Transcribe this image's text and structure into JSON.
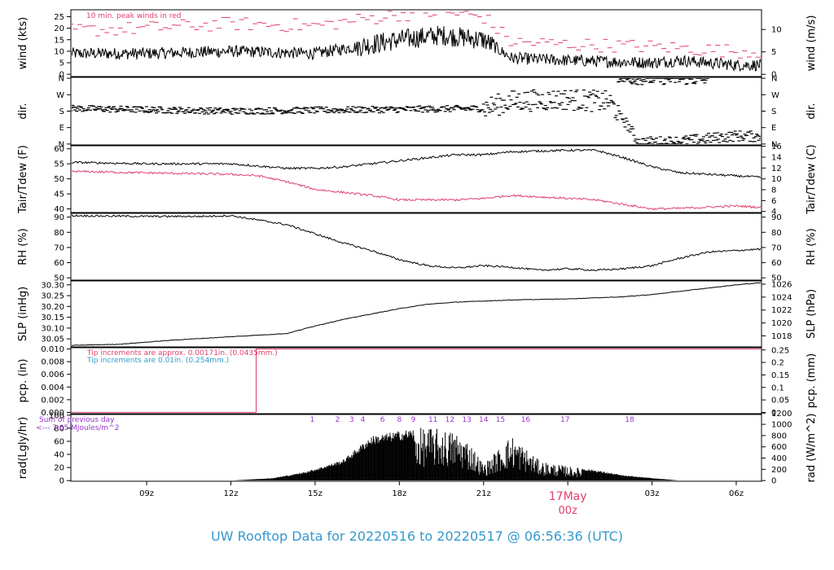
{
  "chart_data": {
    "type": "line",
    "title": "UW Rooftop Data for 20220516  to  20220517 @ 06:56:36  (UTC)",
    "title_color": "#3399cc",
    "time_axis": {
      "ticks": [
        "09z",
        "12z",
        "15z",
        "18z",
        "21z",
        "03z",
        "06z"
      ],
      "tick_hours": [
        9,
        12,
        15,
        18,
        21,
        27,
        30
      ],
      "date_label": "17May",
      "date_sublabel": "00z",
      "date_label_hour": 24,
      "date_color": "#e0406a",
      "range_hours": [
        6.3,
        30.9
      ]
    },
    "panels": [
      {
        "id": "wind",
        "left_label": "wind (kts)",
        "right_label": "wind (m/s)",
        "left_ticks": [
          "0",
          "5",
          "10",
          "15",
          "20",
          "25"
        ],
        "left_tick_values": [
          0,
          5,
          10,
          15,
          20,
          25
        ],
        "right_ticks": [
          "0",
          "5",
          "10"
        ],
        "right_tick_values": [
          0,
          5,
          10
        ],
        "ylim": [
          -1,
          28
        ],
        "right_ylim": [
          -0.5,
          14.4
        ],
        "annotation": "10 min. peak winds in red",
        "annotation_color": "#e0406a",
        "series": [
          {
            "values_hours": [
              6.3,
              9,
              12,
              15,
              18,
              19.5,
              21,
              22,
              24,
              27,
              28,
              30,
              30.9
            ],
            "values": [
              9,
              9,
              10,
              9,
              15,
              17,
              15,
              7,
              6,
              5,
              6,
              4,
              4
            ],
            "color": "#000000"
          },
          {
            "values_hours": [
              6.3,
              9,
              12,
              15,
              18,
              19.5,
              21,
              22,
              24,
              27,
              30,
              30.9
            ],
            "values": [
              19,
              20,
              22,
              21,
              26,
              27,
              25,
              14,
              13,
              12,
              10,
              10
            ],
            "color": "#e0406a",
            "style": "dashes"
          }
        ]
      },
      {
        "id": "dir",
        "left_label": "dir.",
        "right_label": "dir.",
        "left_ticks": [
          "N",
          "E",
          "S",
          "W",
          "N"
        ],
        "left_tick_values": [
          0,
          90,
          180,
          270,
          360
        ],
        "right_ticks": [
          "N",
          "E",
          "S",
          "W",
          "N"
        ],
        "right_tick_values": [
          0,
          90,
          180,
          270,
          360
        ],
        "ylim": [
          -5,
          365
        ],
        "series": [
          {
            "values_hours": [
              6.3,
              12,
              18,
              21,
              22,
              24,
              25.5,
              26.2,
              26.5,
              28,
              30,
              30.9
            ],
            "values": [
              195,
              180,
              190,
              195,
              235,
              245,
              230,
              90,
              10,
              15,
              45,
              40
            ],
            "color": "#000000",
            "style": "dashes"
          },
          {
            "values_hours": [
              25.8,
              27,
              28,
              29
            ],
            "values": [
              355,
              355,
              355,
              350
            ],
            "color": "#000000",
            "style": "dashes"
          }
        ]
      },
      {
        "id": "temp",
        "left_label": "Tair/Tdew (F)",
        "right_label": "Tair/Tdew (C)",
        "left_ticks": [
          "40",
          "45",
          "50",
          "55",
          "60"
        ],
        "left_tick_values": [
          40,
          45,
          50,
          55,
          60
        ],
        "right_ticks": [
          "4",
          "6",
          "8",
          "10",
          "12",
          "14",
          "16"
        ],
        "right_tick_values": [
          4,
          6,
          8,
          10,
          12,
          14,
          16
        ],
        "ylim": [
          38.8,
          61
        ],
        "right_ylim": [
          3.8,
          16.1
        ],
        "series": [
          {
            "name": "Tair",
            "values_hours": [
              6.3,
              9,
              12,
              14,
              15,
              16,
              18,
              20,
              21,
              22,
              24,
              25,
              26,
              27,
              28,
              30,
              30.9
            ],
            "values": [
              55.5,
              55,
              55,
              53.5,
              53.5,
              54,
              56,
              58,
              58,
              59,
              59.5,
              59.5,
              57,
              54,
              52,
              51,
              50.5
            ],
            "color": "#000000"
          },
          {
            "name": "Tdew",
            "values_hours": [
              6.3,
              9,
              12,
              13,
              14,
              15,
              16,
              17,
              18,
              20,
              21,
              22,
              24,
              25,
              26,
              27,
              28,
              30,
              30.9
            ],
            "values": [
              52.5,
              52,
              51.5,
              51,
              49,
              46.5,
              45.5,
              44.5,
              43,
              43,
              43.5,
              44.5,
              43.5,
              43,
              41.5,
              40,
              40.2,
              41,
              40.5
            ],
            "color": "#e0406a"
          }
        ]
      },
      {
        "id": "rh",
        "left_label": "RH (%)",
        "right_label": "RH (%)",
        "left_ticks": [
          "50",
          "60",
          "70",
          "80",
          "90"
        ],
        "left_tick_values": [
          50,
          60,
          70,
          80,
          90
        ],
        "right_ticks": [
          "50",
          "60",
          "70",
          "80",
          "90"
        ],
        "right_tick_values": [
          50,
          60,
          70,
          80,
          90
        ],
        "ylim": [
          48.5,
          92.5
        ],
        "series": [
          {
            "values_hours": [
              6.3,
              9,
              11,
              12,
              13,
              14,
              15,
              16,
              17,
              18,
              19,
              20,
              21,
              22,
              23,
              24,
              25,
              26,
              27,
              28,
              29,
              30,
              30.9
            ],
            "values": [
              91,
              90.5,
              90.5,
              91,
              88,
              85,
              79,
              73,
              68,
              62,
              58,
              56.5,
              58,
              57,
              55,
              56,
              55,
              56,
              58,
              63,
              67,
              68,
              69
            ],
            "color": "#000000"
          }
        ]
      },
      {
        "id": "slp",
        "left_label": "SLP (inHg)",
        "right_label": "SLP (hPa)",
        "left_ticks": [
          "30.05",
          "30.10",
          "30.15",
          "30.20",
          "30.25",
          "30.30"
        ],
        "left_tick_values": [
          30.05,
          30.1,
          30.15,
          30.2,
          30.25,
          30.3
        ],
        "right_ticks": [
          "1018",
          "1020",
          "1022",
          "1024",
          "1026"
        ],
        "right_tick_values": [
          1018,
          1020,
          1022,
          1024,
          1026
        ],
        "ylim": [
          30.013,
          30.318
        ],
        "right_ylim": [
          1016.3,
          1026.5
        ],
        "series": [
          {
            "values_hours": [
              6.3,
              8,
              10,
              12,
              14,
              15,
              16,
              18,
              19,
              20,
              21,
              22,
              24,
              26,
              27,
              28,
              29,
              30,
              30.9
            ],
            "values": [
              30.02,
              30.025,
              30.045,
              30.06,
              30.075,
              30.11,
              30.14,
              30.19,
              30.21,
              30.22,
              30.225,
              30.23,
              30.235,
              30.245,
              30.255,
              30.27,
              30.285,
              30.3,
              30.31
            ],
            "color": "#000000"
          }
        ]
      },
      {
        "id": "pcp",
        "left_label": "pcp. (in)",
        "right_label": "pcp. (mm)",
        "left_ticks": [
          "0.000",
          "0.002",
          "0.004",
          "0.006",
          "0.008",
          "0.010"
        ],
        "left_tick_values": [
          0,
          0.002,
          0.004,
          0.006,
          0.008,
          0.01
        ],
        "right_ticks": [
          "0",
          "0.05",
          "0.1",
          "0.15",
          "0.2",
          "0.25"
        ],
        "right_tick_values": [
          0,
          0.05,
          0.1,
          0.15,
          0.2,
          0.25
        ],
        "ylim": [
          -0.0002,
          0.0102
        ],
        "right_ylim": [
          -0.005,
          0.259
        ],
        "annotations": [
          {
            "text": "Tip increments are approx. 0.00171in. (0.0435mm.)",
            "color": "#e0406a"
          },
          {
            "text": "Tip increments are 0.01in. (0.254mm.)",
            "color": "#3399cc"
          }
        ],
        "series": [
          {
            "values_hours": [
              6.3,
              12.9,
              12.9,
              30.9
            ],
            "values": [
              0,
              0,
              0.01,
              0.01
            ],
            "color": "#e0406a"
          }
        ]
      },
      {
        "id": "rad",
        "left_label": "rad(Lgly/hr)",
        "right_label": "rad (W/m^2)",
        "left_ticks": [
          "0",
          "20",
          "40",
          "60",
          "80",
          "100"
        ],
        "left_tick_values": [
          0,
          20,
          40,
          60,
          80,
          100
        ],
        "right_ticks": [
          "0",
          "200",
          "400",
          "600",
          "800",
          "1000",
          "1200"
        ],
        "right_tick_values": [
          0,
          200,
          400,
          600,
          800,
          1000,
          1200
        ],
        "ylim": [
          -1,
          101
        ],
        "right_ylim": [
          -12,
          1175
        ],
        "annotations": [
          {
            "text": "Sum of previous day",
            "color": "#9933cc"
          },
          {
            "text": "<--- 7.65 MJoules/m^2",
            "color": "#9933cc"
          }
        ],
        "hour_labels": [
          "1",
          "2",
          "3",
          "4",
          "6",
          "8",
          "9",
          "11",
          "12",
          "13",
          "14",
          "15",
          "16",
          "17",
          "18"
        ],
        "hour_label_hours": [
          14.9,
          15.8,
          16.3,
          16.7,
          17.4,
          18,
          18.5,
          19.2,
          19.8,
          20.4,
          21,
          21.6,
          22.5,
          23.9,
          26.2
        ],
        "hour_label_color": "#9933cc",
        "series": [
          {
            "values_hours": [
              12,
              13.5,
              14.5,
              15,
              16,
              17,
              18,
              19,
              20,
              20.5,
              21,
              22,
              23,
              24,
              25,
              26,
              27,
              28
            ],
            "values": [
              0,
              4,
              12,
              18,
              32,
              68,
              76,
              82,
              75,
              60,
              25,
              70,
              30,
              22,
              16,
              8,
              4,
              0
            ],
            "color": "#000000",
            "style": "area"
          }
        ]
      }
    ]
  }
}
